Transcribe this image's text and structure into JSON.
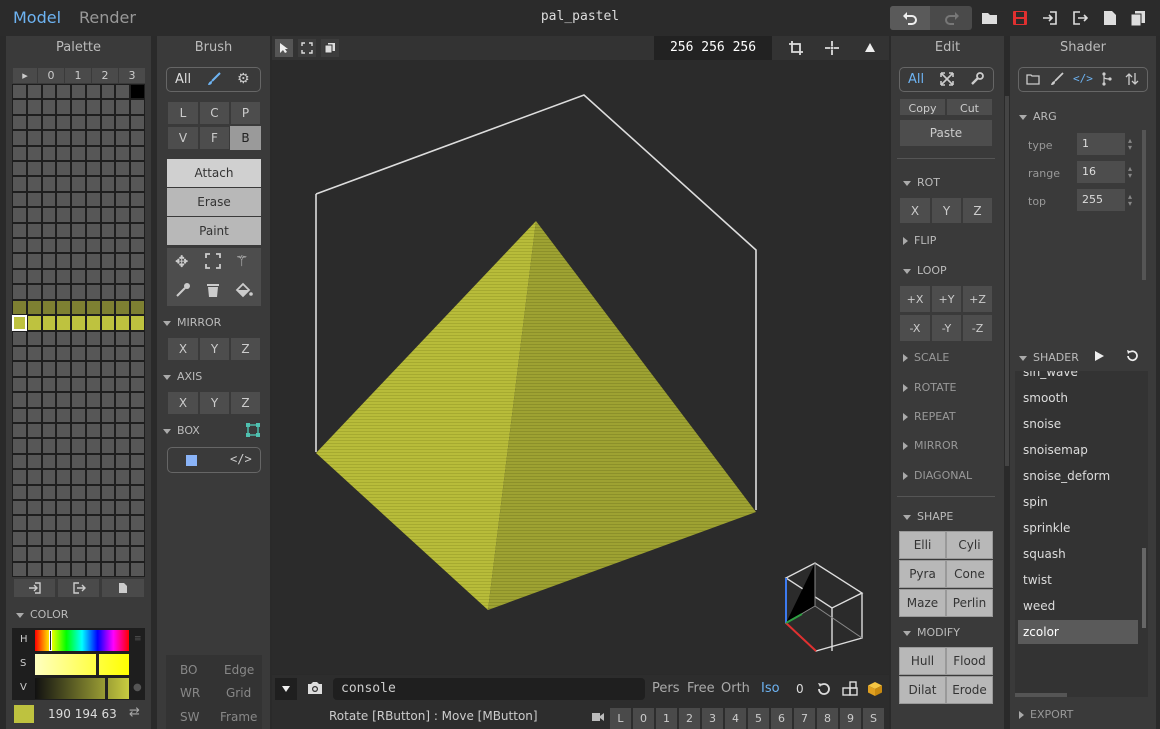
{
  "header": {
    "tabs": [
      "Model",
      "Render"
    ],
    "filename": "pal_pastel"
  },
  "palette": {
    "title": "Palette",
    "index_labels": [
      "▸",
      "0",
      "1",
      "2",
      "3"
    ],
    "color_section": "COLOR",
    "hsv_labels": [
      "H",
      "S",
      "V"
    ],
    "rgb_value": "190 194 63",
    "swatch_color": "#bec23f"
  },
  "brush": {
    "title": "Brush",
    "filter_all": "All",
    "shape_buttons": [
      "L",
      "C",
      "P",
      "V",
      "F",
      "B"
    ],
    "modes": [
      "Attach",
      "Erase",
      "Paint"
    ],
    "mirror_section": "MIRROR",
    "axis_section": "AXIS",
    "box_section": "BOX",
    "xyz": [
      "X",
      "Y",
      "Z"
    ],
    "bottom_labels": [
      "BO",
      "Edge",
      "WR",
      "Grid",
      "SW",
      "Frame"
    ]
  },
  "viewport": {
    "coords": "256 256 256",
    "console_placeholder": "console",
    "view_modes": [
      "Pers",
      "Free",
      "Orth",
      "Iso"
    ],
    "zero_value": "0",
    "status_text": "Rotate [RButton] : Move [MButton]",
    "layer_buttons": [
      "L",
      "0",
      "1",
      "2",
      "3",
      "4",
      "5",
      "6",
      "7",
      "8",
      "9",
      "S"
    ],
    "voxel_color": "#bec23f"
  },
  "edit": {
    "title": "Edit",
    "filter_all": "All",
    "copy": "Copy",
    "cut": "Cut",
    "paste": "Paste",
    "rot_section": "ROT",
    "xyz": [
      "X",
      "Y",
      "Z"
    ],
    "flip_section": "FLIP",
    "loop_section": "LOOP",
    "loop_buttons": [
      "+X",
      "+Y",
      "+Z",
      "-X",
      "-Y",
      "-Z"
    ],
    "collapsed_sections": [
      "SCALE",
      "ROTATE",
      "REPEAT",
      "MIRROR",
      "DIAGONAL"
    ],
    "shape_section": "SHAPE",
    "shape_buttons": [
      "Elli",
      "Cyli",
      "Pyra",
      "Cone",
      "Maze",
      "Perlin"
    ],
    "modify_section": "MODIFY",
    "modify_buttons": [
      "Hull",
      "Flood",
      "Dilat",
      "Erode"
    ]
  },
  "shader": {
    "title": "Shader",
    "arg_section": "ARG",
    "args": [
      {
        "label": "type",
        "value": "1"
      },
      {
        "label": "range",
        "value": "16"
      },
      {
        "label": "top",
        "value": "255"
      }
    ],
    "shader_section": "SHADER",
    "items": [
      "sin_wave",
      "smooth",
      "snoise",
      "snoisemap",
      "snoise_deform",
      "spin",
      "sprinkle",
      "squash",
      "twist",
      "weed",
      "zcolor"
    ],
    "selected": "zcolor",
    "export_section": "EXPORT"
  }
}
